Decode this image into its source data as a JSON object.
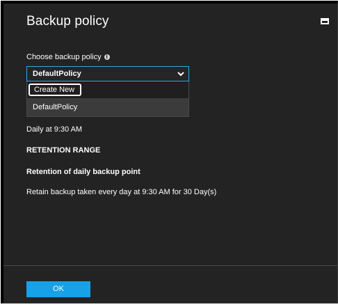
{
  "blade": {
    "title": "Backup policy"
  },
  "policy_field": {
    "label": "Choose backup policy",
    "info_glyph": "i",
    "selected_value": "DefaultPolicy",
    "chevron": "⌵"
  },
  "dropdown": {
    "options": [
      {
        "label": "Create New",
        "highlighted": true
      },
      {
        "label": "DefaultPolicy",
        "selected": true
      }
    ]
  },
  "policy_details": {
    "schedule": "Daily at 9:30 AM",
    "retention_heading": "RETENTION RANGE",
    "daily_heading": "Retention of daily backup point",
    "daily_text": "Retain backup taken every day at 9:30 AM for 30 Day(s)"
  },
  "footer": {
    "ok_label": "OK"
  },
  "colors": {
    "blade_background": "#232323",
    "accent": "#16a1e8",
    "select_border": "#2ea9e6",
    "selected_option": "#3b3b3b"
  },
  "icons": {
    "maximize": "maximize-icon",
    "info": "info-icon",
    "dropdown": "chevron-down-icon"
  }
}
